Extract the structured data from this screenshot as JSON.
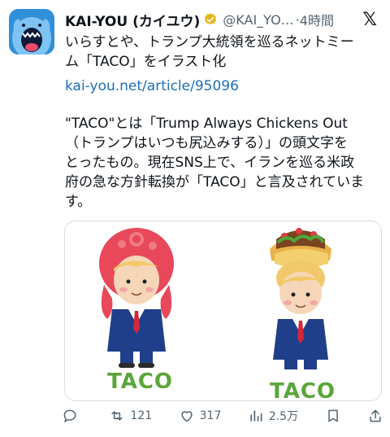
{
  "post": {
    "display_name": "KAI-YOU (カイユウ)",
    "handle": "@KAI_YO…",
    "separator": "·",
    "time": "4時間",
    "text_line1": "いらすとや、トランプ大統領を巡るネットミー",
    "text_line2": "ム「TACO」をイラスト化",
    "link": "kai-you.net/article/95096",
    "para2_line1": "\"TACO\"とは「Trump Always Chickens Out",
    "para2_line2": "（トランプはいつも尻込みする）」の頭文字を",
    "para2_line3": "とったもの。現在SNS上で、イランを巡る米政",
    "para2_line4": "府の急な方針転換が「TACO」と言及されていま",
    "para2_line5": "す。"
  },
  "media": {
    "left_caption": "TACO",
    "right_caption": "TACO"
  },
  "actions": {
    "reply_count": "",
    "retweet_count": "121",
    "like_count": "317",
    "views_count": "2.5万",
    "bookmark_count": "",
    "share_count": ""
  },
  "colors": {
    "accent_link": "#1d6fb8",
    "verified_gold": "#e2b719",
    "taco_green": "#5aa63a",
    "avatar_blue": "#2f8fd8"
  },
  "icons": [
    "avatar-monster-icon",
    "verified-badge-icon",
    "x-logo-icon",
    "reply-icon",
    "retweet-icon",
    "like-icon",
    "views-icon",
    "bookmark-icon",
    "share-icon"
  ]
}
